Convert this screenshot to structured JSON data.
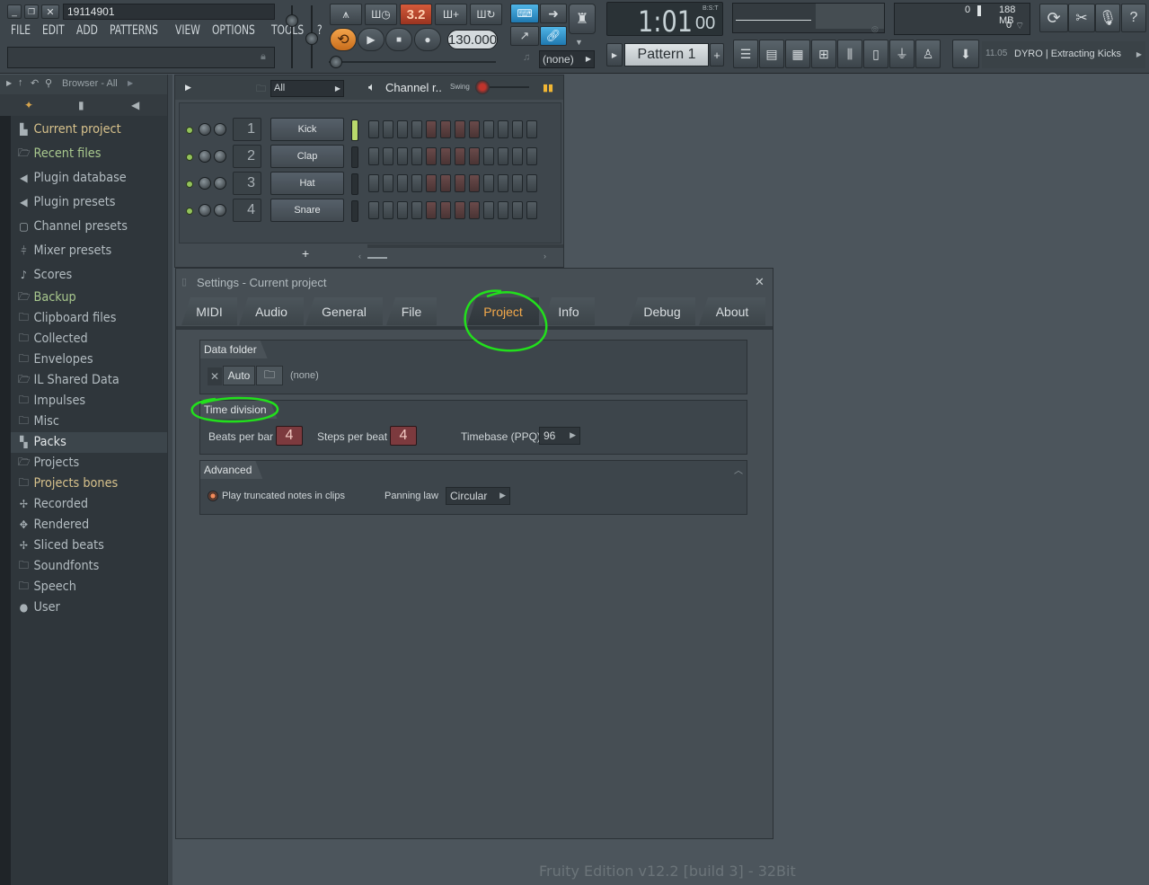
{
  "titlebar": {
    "project_name": "19114901"
  },
  "menu": [
    "FILE",
    "EDIT",
    "ADD",
    "PATTERNS",
    "VIEW",
    "OPTIONS",
    "TOOLS",
    "?"
  ],
  "transport": {
    "mode": "3.2",
    "tempo": "130.000",
    "time": "1:01",
    "time_sub": "00",
    "time_mode": "B:S:T"
  },
  "pattern": {
    "label": "Pattern 1",
    "midi_dev": "(none)"
  },
  "cpu": {
    "voices": "0",
    "memory": "188 MB",
    "polyphony": "0"
  },
  "hint": {
    "time": "11.05",
    "text": "DYRO | Extracting Kicks"
  },
  "browser": {
    "title": "Browser - All",
    "items": [
      {
        "label": "Current project",
        "icon": "project-icon",
        "style": "orange"
      },
      {
        "label": "Recent files",
        "icon": "recent-files-icon",
        "style": "green"
      },
      {
        "label": "Plugin database",
        "icon": "plugin-database-icon",
        "style": "normal"
      },
      {
        "label": "Plugin presets",
        "icon": "plugin-presets-icon",
        "style": "normal"
      },
      {
        "label": "Channel presets",
        "icon": "channel-presets-icon",
        "style": "normal"
      },
      {
        "label": "Mixer presets",
        "icon": "mixer-presets-icon",
        "style": "normal"
      },
      {
        "label": "Scores",
        "icon": "note-icon",
        "style": "normal"
      },
      {
        "label": "Backup",
        "icon": "backup-icon",
        "style": "green"
      },
      {
        "label": "Clipboard files",
        "icon": "folder-icon",
        "style": "normal"
      },
      {
        "label": "Collected",
        "icon": "folder-icon",
        "style": "normal"
      },
      {
        "label": "Envelopes",
        "icon": "folder-icon",
        "style": "normal"
      },
      {
        "label": "IL Shared Data",
        "icon": "folder-link-icon",
        "style": "normal"
      },
      {
        "label": "Impulses",
        "icon": "folder-icon",
        "style": "normal"
      },
      {
        "label": "Misc",
        "icon": "folder-icon",
        "style": "normal"
      },
      {
        "label": "Packs",
        "icon": "packs-icon",
        "style": "sel"
      },
      {
        "label": "Projects",
        "icon": "folder-link-icon",
        "style": "normal"
      },
      {
        "label": "Projects bones",
        "icon": "folder-icon",
        "style": "orange"
      },
      {
        "label": "Recorded",
        "icon": "recorded-icon",
        "style": "normal"
      },
      {
        "label": "Rendered",
        "icon": "rendered-icon",
        "style": "normal"
      },
      {
        "label": "Sliced beats",
        "icon": "sliced-icon",
        "style": "normal"
      },
      {
        "label": "Soundfonts",
        "icon": "folder-icon",
        "style": "normal"
      },
      {
        "label": "Speech",
        "icon": "folder-icon",
        "style": "normal"
      },
      {
        "label": "User",
        "icon": "user-icon",
        "style": "normal"
      }
    ]
  },
  "channel_rack": {
    "filter": "All",
    "title": "Channel r..",
    "swing_label": "Swing",
    "channels": [
      {
        "num": "1",
        "name": "Kick"
      },
      {
        "num": "2",
        "name": "Clap"
      },
      {
        "num": "3",
        "name": "Hat"
      },
      {
        "num": "4",
        "name": "Snare"
      }
    ],
    "add_label": "+"
  },
  "settings": {
    "title": "Settings - Current project",
    "tabs": [
      "MIDI",
      "Audio",
      "General",
      "File",
      "Project",
      "Info",
      "Debug",
      "About"
    ],
    "active_tab": "Project",
    "data_folder": {
      "heading": "Data folder",
      "auto_label": "Auto",
      "value": "(none)"
    },
    "time_division": {
      "heading": "Time division",
      "beats_per_bar_label": "Beats per bar",
      "beats_per_bar": "4",
      "steps_per_beat_label": "Steps per beat",
      "steps_per_beat": "4",
      "timebase_label": "Timebase (PPQ)",
      "timebase": "96"
    },
    "advanced": {
      "heading": "Advanced",
      "play_truncated_label": "Play truncated notes in clips",
      "panning_law_label": "Panning law",
      "panning_law": "Circular"
    }
  },
  "footer": {
    "version": "Fruity Edition v12.2 [build 3] - 32Bit"
  },
  "colors": {
    "accent_orange": "#f3a94a",
    "annotation_green": "#22e01c",
    "step_red": "#6a4a4a",
    "value_red": "#7c3a3e"
  }
}
